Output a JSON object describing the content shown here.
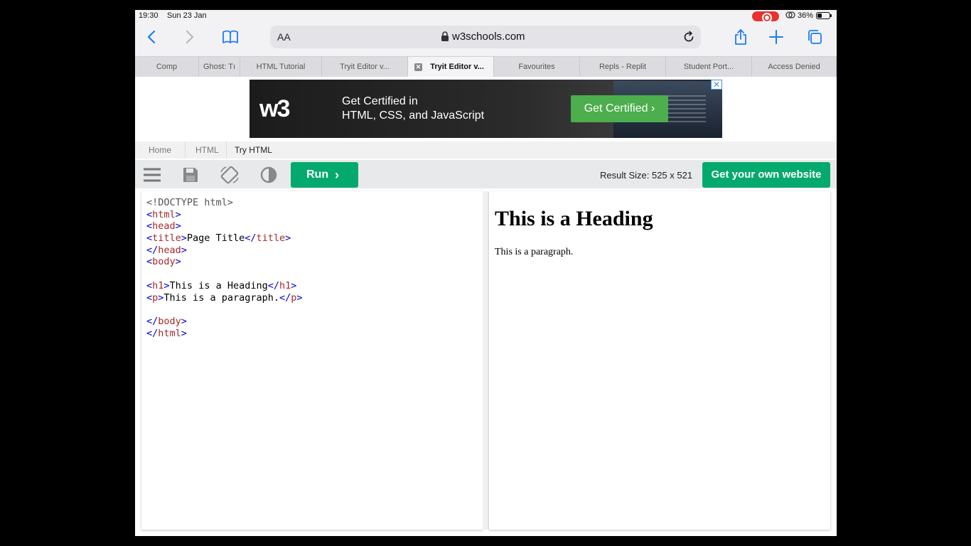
{
  "status_bar": {
    "time": "19:30",
    "date": "Sun 23 Jan",
    "battery": "36%"
  },
  "toolbar": {
    "reader_label": "AA",
    "url": "w3schools.com"
  },
  "tabs": [
    {
      "label": "Comp",
      "active": false
    },
    {
      "label": "Ghost: Tı",
      "active": false
    },
    {
      "label": "HTML Tutorial",
      "active": false
    },
    {
      "label": "Tryit Editor v...",
      "active": false
    },
    {
      "label": "Tryit Editor v...",
      "active": true
    },
    {
      "label": "Favourites",
      "active": false
    },
    {
      "label": "Repls - Replit",
      "active": false
    },
    {
      "label": "Student Port...",
      "active": false
    },
    {
      "label": "Access Denied",
      "active": false
    }
  ],
  "ad": {
    "logo": "w3",
    "line1": "Get Certified in",
    "line2": "HTML, CSS, and JavaScript",
    "cta": "Get Certified ›",
    "close": "✕"
  },
  "breadcrumb": [
    "Home",
    "HTML",
    "Try HTML"
  ],
  "tools": {
    "run_label": "Run",
    "result_size": "Result Size: 525 x 521",
    "get_site_label": "Get your own website"
  },
  "editor": {
    "doctype": "<!DOCTYPE html>",
    "title_text": "Page Title",
    "h1_text": "This is a Heading",
    "p_text": "This is a paragraph."
  },
  "result": {
    "heading": "This is a Heading",
    "paragraph": "This is a paragraph."
  },
  "colors": {
    "accent_green": "#04aa6d",
    "ios_blue": "#1b7cf5",
    "record_red": "#e8322f"
  }
}
